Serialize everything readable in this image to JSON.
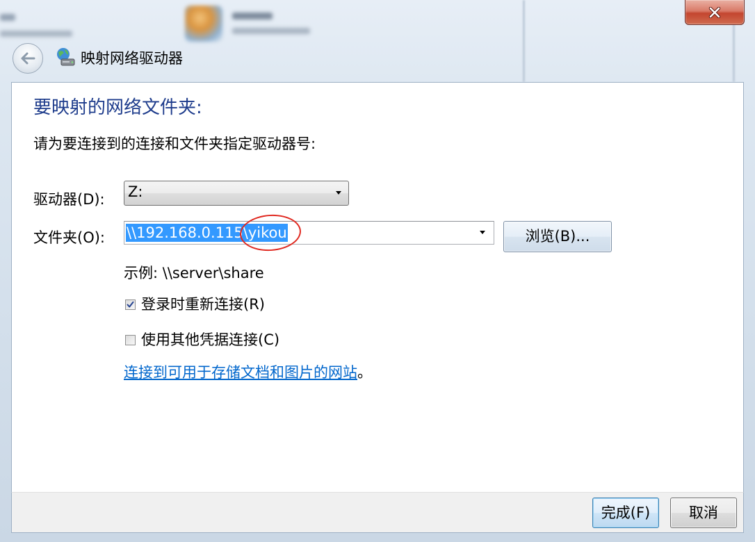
{
  "window": {
    "title": "映射网络驱动器",
    "icons": {
      "back": "back-arrow-icon",
      "app": "network-drive-icon",
      "close": "close-icon"
    }
  },
  "main": {
    "heading": "要映射的网络文件夹:",
    "instruction": "请为要连接到的连接和文件夹指定驱动器号:",
    "drive": {
      "label": "驱动器(D):",
      "value": "Z:"
    },
    "folder": {
      "label": "文件夹(O):",
      "value": "\\\\192.168.0.115\\yikou",
      "browse_label": "浏览(B)..."
    },
    "example": "示例: \\\\server\\share",
    "options": [
      {
        "label": "登录时重新连接(R)",
        "checked": true
      },
      {
        "label": "使用其他凭据连接(C)",
        "checked": false
      }
    ],
    "link": {
      "text": "连接到可用于存储文档和图片的网站",
      "suffix": "。"
    }
  },
  "footer": {
    "finish_label": "完成(F)",
    "cancel_label": "取消"
  },
  "colors": {
    "heading": "#1e3c8c",
    "link": "#0066cc",
    "selection": "#3399ff",
    "annotation": "#e0281f"
  }
}
